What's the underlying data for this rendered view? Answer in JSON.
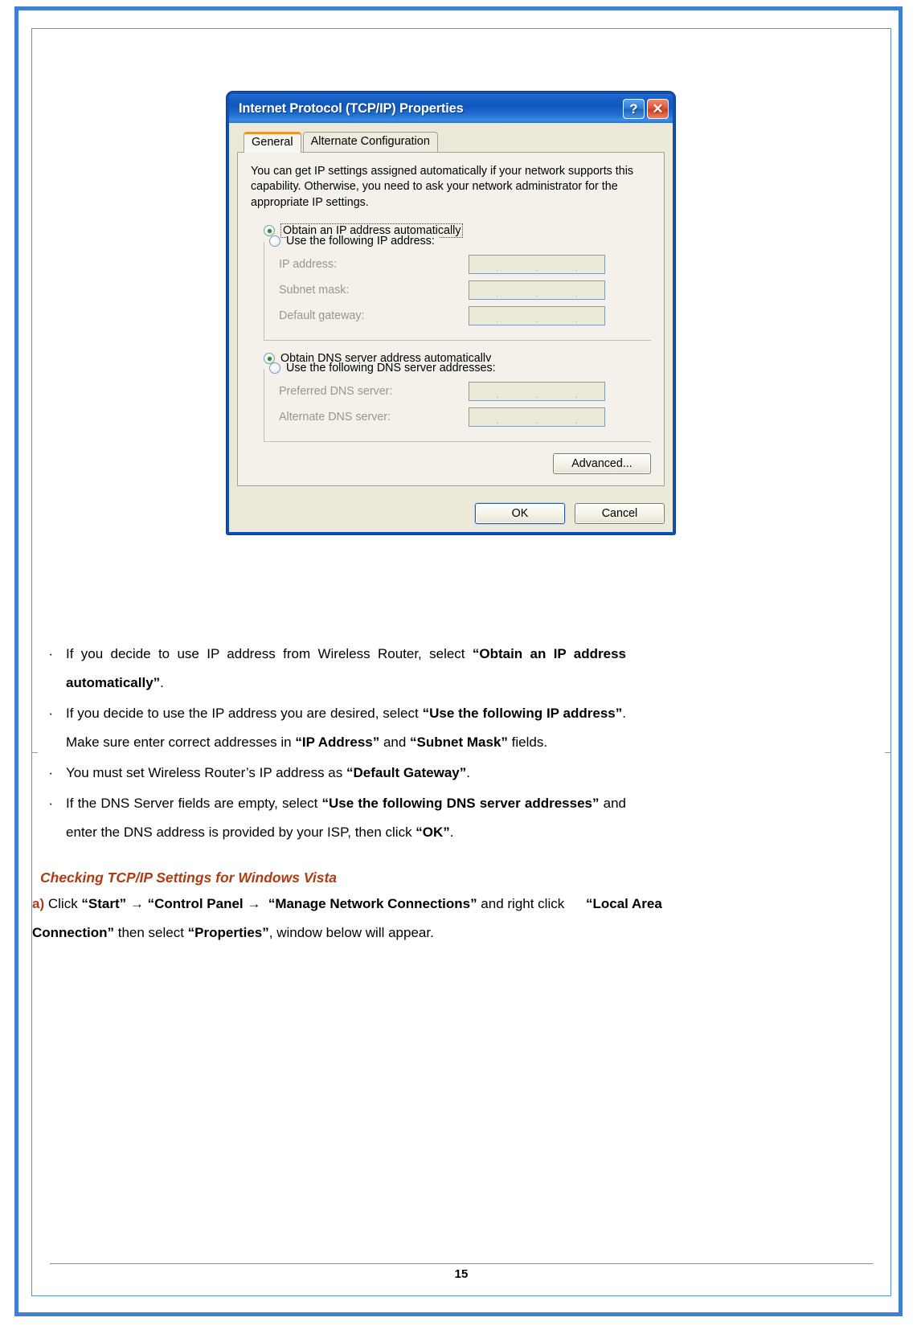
{
  "dialog": {
    "title": "Internet Protocol (TCP/IP) Properties",
    "help_button": "?",
    "close_button": "✕",
    "tabs": [
      {
        "label": "General",
        "active": true
      },
      {
        "label": "Alternate Configuration",
        "active": false
      }
    ],
    "description": "You can get IP settings assigned automatically if your network supports this capability. Otherwise, you need to ask your network administrator for the appropriate IP settings.",
    "ip_section": {
      "auto_option": "Obtain an IP address automatically",
      "auto_selected": true,
      "manual_option": "Use the following IP address:",
      "manual_selected": false,
      "fields": [
        {
          "label": "IP address:",
          "value": ""
        },
        {
          "label": "Subnet mask:",
          "value": ""
        },
        {
          "label": "Default gateway:",
          "value": ""
        }
      ]
    },
    "dns_section": {
      "auto_option": "Obtain DNS server address automatically",
      "auto_selected": true,
      "manual_option": "Use the following DNS server addresses:",
      "manual_selected": false,
      "fields": [
        {
          "label": "Preferred DNS server:",
          "value": ""
        },
        {
          "label": "Alternate DNS server:",
          "value": ""
        }
      ]
    },
    "advanced_button": "Advanced...",
    "ok_button": "OK",
    "cancel_button": "Cancel",
    "ip_separator": "."
  },
  "document": {
    "bullet_marker": "·",
    "bullets": [
      "If you decide to use IP address from Wireless Router, select “Obtain an IP address automatically”.",
      "If you decide to use the IP address you are desired, select “Use the following IP address”. Make sure enter correct addresses in “IP Address” and “Subnet Mask” fields.",
      "You must set Wireless Router’s IP address as “Default Gateway”.",
      "If the DNS Server fields are empty, select “Use the following DNS server addresses” and enter the DNS address is provided by your ISP, then click “OK”."
    ],
    "section_heading": "Checking TCP/IP Settings for Windows Vista",
    "step": {
      "marker": "a)",
      "line1_pre": "Click ",
      "start": "“Start”",
      "arrow": "→",
      "control_panel": "“Control Panel →",
      "manage": "“Manage Network Connections”",
      "line1_post": " and right click",
      "local_area": "“Local Area Connection”",
      "line2_mid": " then select ",
      "properties": "“Properties”",
      "line2_post": ", window below will appear."
    },
    "page_number": "15"
  }
}
